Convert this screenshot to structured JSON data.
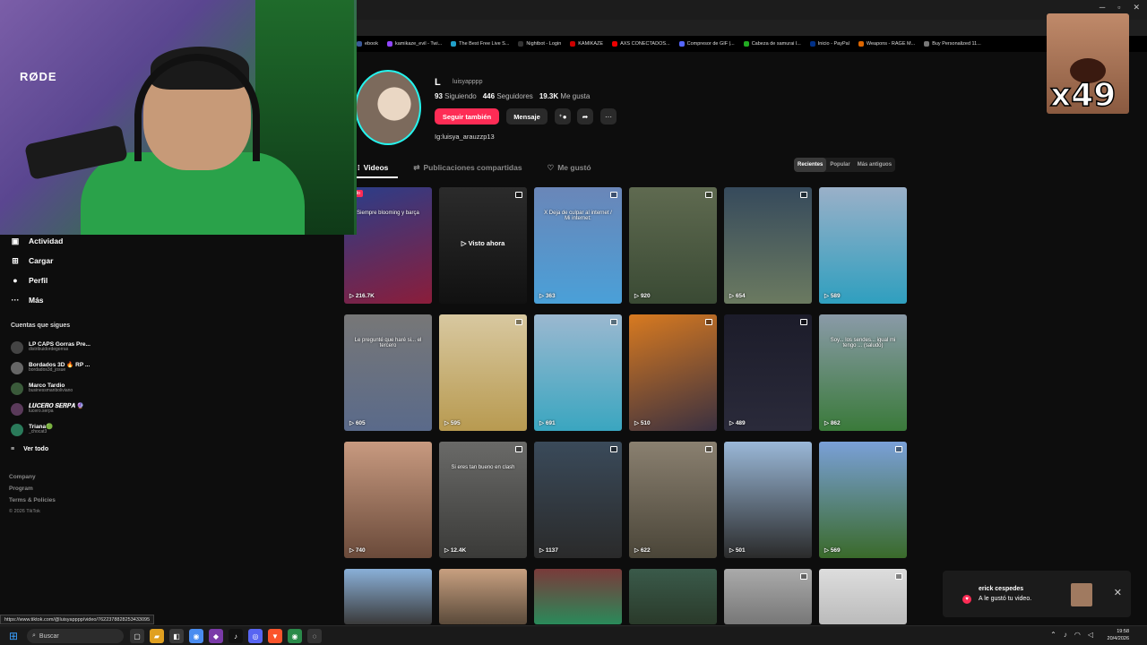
{
  "browser": {
    "bookmarks": [
      {
        "label": "ebook",
        "color": "#3b5998"
      },
      {
        "label": "kamikaze_evil - Twi...",
        "color": "#9146ff"
      },
      {
        "label": "The Best Free Live S...",
        "color": "#21a0c9"
      },
      {
        "label": "Nightbot - Login",
        "color": "#333"
      },
      {
        "label": "KAMIKAZE",
        "color": "#c00"
      },
      {
        "label": "AXS CONECTADOS...",
        "color": "#e00"
      },
      {
        "label": "Compresor de GIF |...",
        "color": "#5566ff"
      },
      {
        "label": "Cabeza de samurai l...",
        "color": "#2a2"
      },
      {
        "label": "Inicio - PayPal",
        "color": "#003087"
      },
      {
        "label": "Weapons - RAGE M...",
        "color": "#d60"
      },
      {
        "label": "Buy Personalized 11...",
        "color": "#777"
      }
    ],
    "status_url": "https://www.tiktok.com/@luisyapppp/video/7622378828253433095"
  },
  "webcam": {
    "mic_brand": "RØDE"
  },
  "meme": {
    "count": "x49"
  },
  "sidebar": {
    "items": [
      {
        "label": "Actividad",
        "icon": "activity-icon",
        "glyph": "▣"
      },
      {
        "label": "Cargar",
        "icon": "upload-icon",
        "glyph": "⊞"
      },
      {
        "label": "Perfil",
        "icon": "profile-icon",
        "glyph": "●"
      },
      {
        "label": "Más",
        "icon": "more-icon",
        "glyph": "···"
      }
    ],
    "following_title": "Cuentas que sigues",
    "accounts": [
      {
        "name": "LP CAPS Gorras Pre...",
        "handle": "distribuidordegorras"
      },
      {
        "name": "Bordados 3D 🔥 RP ...",
        "handle": "bordados3d_josue"
      },
      {
        "name": "Marco Tardio",
        "handle": "businessmanbolivianο"
      },
      {
        "name": "𝑳𝑼𝑪𝑬𝑹𝑶 𝑺𝑬𝑹𝑷𝑨 🔮",
        "handle": "lucero.serpa"
      },
      {
        "name": "Triana🟢",
        "handle": "_chocat3"
      }
    ],
    "see_all": "Ver todo",
    "footer": [
      "Company",
      "Program",
      "Terms & Policies"
    ],
    "copyright": "© 2026 TikTok"
  },
  "profile": {
    "name": "L",
    "handle": "luisyapppp",
    "following_count": "93",
    "following_label": "Siguiendo",
    "followers_count": "446",
    "followers_label": "Seguidores",
    "likes_count": "19.3K",
    "likes_label": "Me gusta",
    "follow_button": "Seguir también",
    "message_button": "Mensaje",
    "bio": "Ig:luisya_arauzzp13"
  },
  "tabs": [
    {
      "label": "Videos",
      "icon": "grid-icon",
      "active": true
    },
    {
      "label": "Publicaciones compartidas",
      "icon": "repost-icon",
      "active": false
    },
    {
      "label": "Me gustó",
      "icon": "heart-outline-icon",
      "active": false
    }
  ],
  "sort": [
    {
      "label": "Recientes",
      "active": true
    },
    {
      "label": "Popular",
      "active": false
    },
    {
      "label": "Más antiguos",
      "active": false
    }
  ],
  "videos": [
    {
      "views": "216.7K",
      "caption": "Siempre blooming y barça",
      "badge": "Fijado",
      "bg": "linear-gradient(160deg,#2a3e8a,#8b1d3a)",
      "pinned": false
    },
    {
      "views": "",
      "caption": "",
      "center": "▷ Visto ahora",
      "bg": "linear-gradient(180deg,#2b2b2b,#111)",
      "pinned": true
    },
    {
      "views": "363",
      "caption": "X Deja de culpar al internet / Mi internet:",
      "bg": "linear-gradient(180deg,#6a86b8,#4aa0d8)",
      "pinned": true
    },
    {
      "views": "920",
      "caption": "",
      "bg": "linear-gradient(180deg,#5f6a50,#3a4a34)",
      "pinned": true
    },
    {
      "views": "654",
      "caption": "",
      "bg": "linear-gradient(180deg,#364a5c,#6b7a60)",
      "pinned": true
    },
    {
      "views": "589",
      "caption": "",
      "bg": "linear-gradient(180deg,#9ab0c8,#2f9fbf)",
      "pinned": false
    },
    {
      "views": "605",
      "caption": "Le pregunté que haré si... el tercero",
      "bg": "linear-gradient(180deg,#777,#5a6a8a)",
      "pinned": false
    },
    {
      "views": "595",
      "caption": "",
      "bg": "linear-gradient(180deg,#d8c8a0,#b89a50)",
      "pinned": true
    },
    {
      "views": "691",
      "caption": "",
      "bg": "linear-gradient(180deg,#9bb8d0,#3aa6c0)",
      "pinned": true
    },
    {
      "views": "510",
      "caption": "",
      "bg": "linear-gradient(160deg,#d87a20,#3a3040)",
      "pinned": true
    },
    {
      "views": "489",
      "caption": "",
      "bg": "linear-gradient(180deg,#1c1c2a,#2a2a3a)",
      "pinned": true
    },
    {
      "views": "862",
      "caption": "Soy... los sendes... igual mi tengo ... (saludo)",
      "bg": "linear-gradient(180deg,#8a9aa8,#3a7a3a)",
      "pinned": false
    },
    {
      "views": "740",
      "caption": "",
      "bg": "linear-gradient(180deg,#c89a80,#6a4a3a)",
      "pinned": false
    },
    {
      "views": "12.4K",
      "caption": "Si eres tan bueno en clash",
      "bg": "linear-gradient(180deg,#6a6a68,#3a3a38)",
      "pinned": true
    },
    {
      "views": "1137",
      "caption": "",
      "bg": "linear-gradient(180deg,#3a4a5a,#2a2a2a)",
      "pinned": true
    },
    {
      "views": "622",
      "caption": "",
      "bg": "linear-gradient(180deg,#8a8070,#4a4538)",
      "pinned": true
    },
    {
      "views": "501",
      "caption": "",
      "bg": "linear-gradient(180deg,#9ab8d8,#2a2a2a)",
      "pinned": false
    },
    {
      "views": "569",
      "caption": "",
      "bg": "linear-gradient(180deg,#7aa0d8,#3a6a2a)",
      "pinned": true
    },
    {
      "views": "",
      "caption": "",
      "bg": "linear-gradient(180deg,#8ab0d8,#3a3a3a)",
      "pinned": false
    },
    {
      "views": "",
      "caption": "",
      "bg": "linear-gradient(180deg,#c8a080,#5a4a3a)",
      "pinned": false
    },
    {
      "views": "",
      "caption": "",
      "bg": "linear-gradient(180deg,#7a3a3a,#2a8a5a)",
      "pinned": false
    },
    {
      "views": "",
      "caption": "",
      "bg": "linear-gradient(180deg,#3a5a4a,#2a3a2a)",
      "pinned": false
    },
    {
      "views": "",
      "caption": "",
      "bg": "linear-gradient(180deg,#aaa,#777)",
      "pinned": true
    },
    {
      "views": "",
      "caption": "",
      "bg": "linear-gradient(180deg,#ddd,#bbb)",
      "pinned": true
    }
  ],
  "notification": {
    "who": "erick cespedes",
    "message": "A le gustó tu video."
  },
  "taskbar": {
    "search": "Buscar",
    "time": "19:58",
    "date": "20/4/2026"
  }
}
